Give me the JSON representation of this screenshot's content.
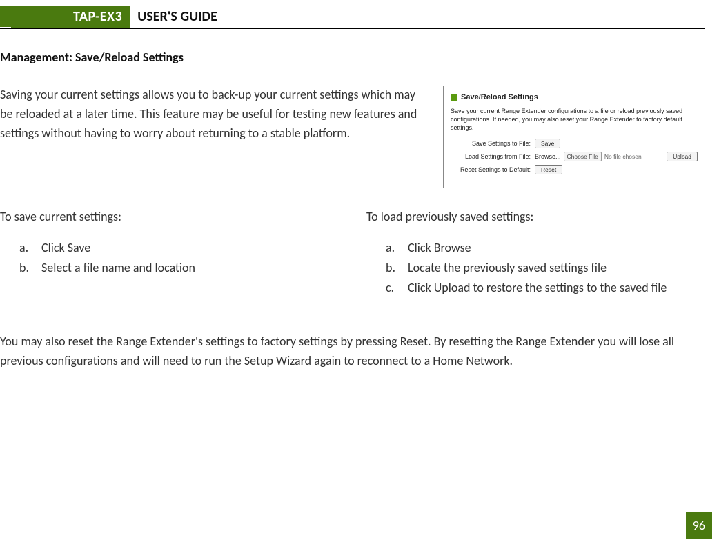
{
  "header": {
    "model": "TAP-EX3",
    "guide": "USER'S GUIDE"
  },
  "section_heading": "Management: Save/Reload Settings",
  "intro": "Saving your current settings allows you to back-up your current settings which may be reloaded at a later time. This feature may be useful for testing new features and settings without having to worry about returning to a stable platform.",
  "screenshot": {
    "title": "Save/Reload Settings",
    "description": "Save your current Range Extender configurations to a file or reload previously saved configurations. If needed, you may also reset your Range Extender to factory default settings.",
    "rows": {
      "save_label": "Save Settings to File:",
      "save_btn": "Save",
      "load_label": "Load Settings from File:",
      "browse_text": "Browse...",
      "choose_btn": "Choose File",
      "nofile": "No file chosen",
      "upload_btn": "Upload",
      "reset_label": "Reset Settings to Default:",
      "reset_btn": "Reset"
    }
  },
  "left_col": {
    "heading": "To save current settings:",
    "items": [
      {
        "m": "a.",
        "t": "Click Save"
      },
      {
        "m": "b.",
        "t": "Select a file name and location"
      }
    ]
  },
  "right_col": {
    "heading": "To load previously saved settings:",
    "items": [
      {
        "m": "a.",
        "t": "Click Browse"
      },
      {
        "m": "b.",
        "t": "Locate the previously saved settings file"
      },
      {
        "m": "c.",
        "t": "Click Upload to restore the settings to the saved file"
      }
    ]
  },
  "reset_paragraph": "You may also reset the Range Extender's settings to factory settings by pressing Reset. By resetting the Range Extender you will lose all previous configurations and will need to run the Setup Wizard again to reconnect to a Home Network.",
  "page_number": "96"
}
